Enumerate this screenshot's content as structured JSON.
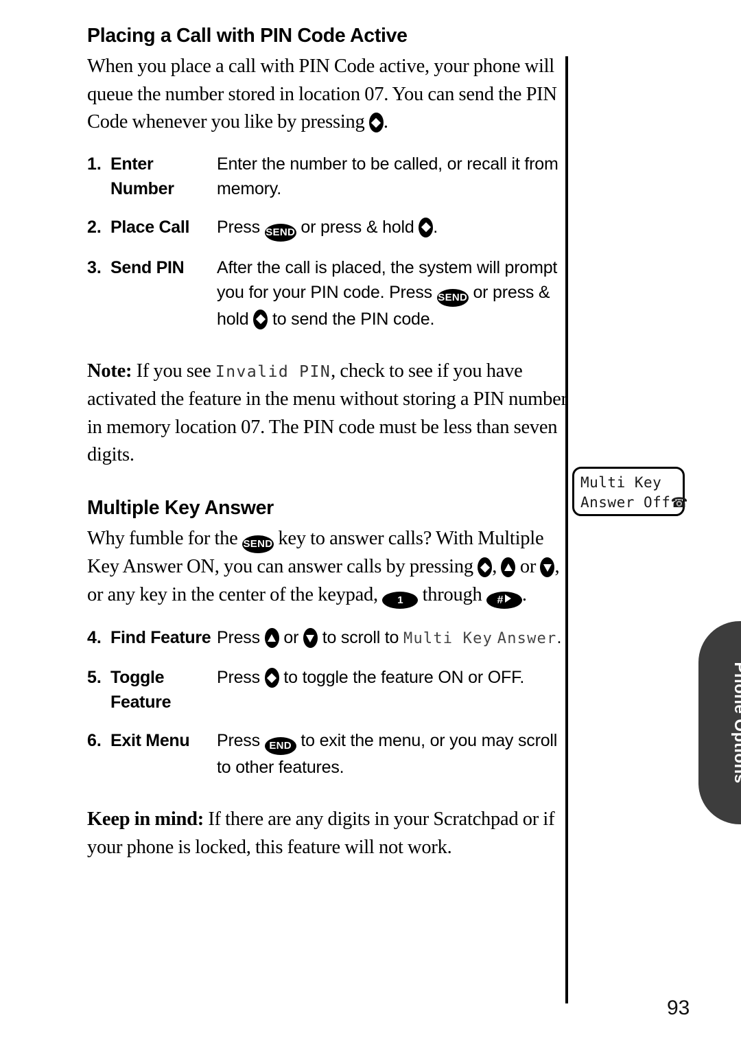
{
  "document": {
    "page_number": "93",
    "side_tab_label": "Phone Options"
  },
  "section_one": {
    "heading": "Placing a Call with PIN Code Active",
    "intro_part1": "When you place a call with PIN Code active, your phone will queue the number stored in location 07. You can send the PIN Code whenever you like by pressing ",
    "intro_part2": ".",
    "steps": [
      {
        "number": "1.",
        "term": "Enter Number",
        "desc": "Enter the number to be called, or recall it from memory."
      },
      {
        "number": "2.",
        "term": "Place Call",
        "desc_part1": "Press ",
        "desc_part2": " or press & hold ",
        "desc_part3": "."
      },
      {
        "number": "3.",
        "term": "Send PIN",
        "desc_part1": "After the call is placed, the system will prompt you for your PIN code. Press ",
        "desc_part2": " or press & hold ",
        "desc_part3": " to send the PIN code."
      }
    ],
    "note_label": "Note:",
    "note_part1": " If you see ",
    "note_lcd": "Invalid PIN",
    "note_part2": ", check to see if you have activated the feature in the menu without storing a PIN number in memory location 07. The PIN code must be less than seven digits."
  },
  "section_two": {
    "heading": "Multiple Key Answer",
    "intro_part1": "Why fumble for the ",
    "intro_part2": " key to answer calls? With Multiple Key Answer ON, you can answer calls by pressing ",
    "intro_part3": ", ",
    "intro_part4": " or ",
    "intro_part5": ", or any key in the center of the keypad, ",
    "intro_part6": " through ",
    "intro_part7": ".",
    "steps": [
      {
        "number": "4.",
        "term": "Find Feature",
        "desc_part1": "Press ",
        "desc_part2": " or ",
        "desc_part3": " to scroll to ",
        "desc_lcd1": "Multi Key",
        "desc_lcd2": "Answer",
        "desc_part4": "."
      },
      {
        "number": "5.",
        "term": "Toggle Feature",
        "desc_part1": "Press ",
        "desc_part2": " to toggle the feature ON or OFF."
      },
      {
        "number": "6.",
        "term": "Exit Menu",
        "desc_part1": "Press ",
        "desc_part2": " to exit the menu, or you may scroll to other features."
      }
    ],
    "keepinmind_label": "Keep in mind:",
    "keepinmind_text": " If there are any digits in your Scratchpad or if your phone is locked, this feature will not work."
  },
  "lcd_display": {
    "line1": "Multi Key",
    "line2": "Answer Off",
    "icon": "☎"
  },
  "keys": {
    "send": "SEND",
    "end": "END",
    "one": "1",
    "hash": "#"
  }
}
